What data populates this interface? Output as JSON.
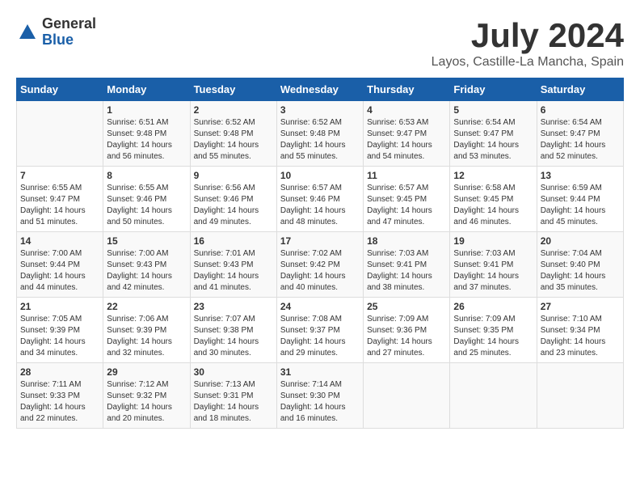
{
  "logo": {
    "general": "General",
    "blue": "Blue"
  },
  "title": "July 2024",
  "location": "Layos, Castille-La Mancha, Spain",
  "days_of_week": [
    "Sunday",
    "Monday",
    "Tuesday",
    "Wednesday",
    "Thursday",
    "Friday",
    "Saturday"
  ],
  "weeks": [
    [
      {
        "day": "",
        "info": ""
      },
      {
        "day": "1",
        "info": "Sunrise: 6:51 AM\nSunset: 9:48 PM\nDaylight: 14 hours\nand 56 minutes."
      },
      {
        "day": "2",
        "info": "Sunrise: 6:52 AM\nSunset: 9:48 PM\nDaylight: 14 hours\nand 55 minutes."
      },
      {
        "day": "3",
        "info": "Sunrise: 6:52 AM\nSunset: 9:48 PM\nDaylight: 14 hours\nand 55 minutes."
      },
      {
        "day": "4",
        "info": "Sunrise: 6:53 AM\nSunset: 9:47 PM\nDaylight: 14 hours\nand 54 minutes."
      },
      {
        "day": "5",
        "info": "Sunrise: 6:54 AM\nSunset: 9:47 PM\nDaylight: 14 hours\nand 53 minutes."
      },
      {
        "day": "6",
        "info": "Sunrise: 6:54 AM\nSunset: 9:47 PM\nDaylight: 14 hours\nand 52 minutes."
      }
    ],
    [
      {
        "day": "7",
        "info": "Sunrise: 6:55 AM\nSunset: 9:47 PM\nDaylight: 14 hours\nand 51 minutes."
      },
      {
        "day": "8",
        "info": "Sunrise: 6:55 AM\nSunset: 9:46 PM\nDaylight: 14 hours\nand 50 minutes."
      },
      {
        "day": "9",
        "info": "Sunrise: 6:56 AM\nSunset: 9:46 PM\nDaylight: 14 hours\nand 49 minutes."
      },
      {
        "day": "10",
        "info": "Sunrise: 6:57 AM\nSunset: 9:46 PM\nDaylight: 14 hours\nand 48 minutes."
      },
      {
        "day": "11",
        "info": "Sunrise: 6:57 AM\nSunset: 9:45 PM\nDaylight: 14 hours\nand 47 minutes."
      },
      {
        "day": "12",
        "info": "Sunrise: 6:58 AM\nSunset: 9:45 PM\nDaylight: 14 hours\nand 46 minutes."
      },
      {
        "day": "13",
        "info": "Sunrise: 6:59 AM\nSunset: 9:44 PM\nDaylight: 14 hours\nand 45 minutes."
      }
    ],
    [
      {
        "day": "14",
        "info": "Sunrise: 7:00 AM\nSunset: 9:44 PM\nDaylight: 14 hours\nand 44 minutes."
      },
      {
        "day": "15",
        "info": "Sunrise: 7:00 AM\nSunset: 9:43 PM\nDaylight: 14 hours\nand 42 minutes."
      },
      {
        "day": "16",
        "info": "Sunrise: 7:01 AM\nSunset: 9:43 PM\nDaylight: 14 hours\nand 41 minutes."
      },
      {
        "day": "17",
        "info": "Sunrise: 7:02 AM\nSunset: 9:42 PM\nDaylight: 14 hours\nand 40 minutes."
      },
      {
        "day": "18",
        "info": "Sunrise: 7:03 AM\nSunset: 9:41 PM\nDaylight: 14 hours\nand 38 minutes."
      },
      {
        "day": "19",
        "info": "Sunrise: 7:03 AM\nSunset: 9:41 PM\nDaylight: 14 hours\nand 37 minutes."
      },
      {
        "day": "20",
        "info": "Sunrise: 7:04 AM\nSunset: 9:40 PM\nDaylight: 14 hours\nand 35 minutes."
      }
    ],
    [
      {
        "day": "21",
        "info": "Sunrise: 7:05 AM\nSunset: 9:39 PM\nDaylight: 14 hours\nand 34 minutes."
      },
      {
        "day": "22",
        "info": "Sunrise: 7:06 AM\nSunset: 9:39 PM\nDaylight: 14 hours\nand 32 minutes."
      },
      {
        "day": "23",
        "info": "Sunrise: 7:07 AM\nSunset: 9:38 PM\nDaylight: 14 hours\nand 30 minutes."
      },
      {
        "day": "24",
        "info": "Sunrise: 7:08 AM\nSunset: 9:37 PM\nDaylight: 14 hours\nand 29 minutes."
      },
      {
        "day": "25",
        "info": "Sunrise: 7:09 AM\nSunset: 9:36 PM\nDaylight: 14 hours\nand 27 minutes."
      },
      {
        "day": "26",
        "info": "Sunrise: 7:09 AM\nSunset: 9:35 PM\nDaylight: 14 hours\nand 25 minutes."
      },
      {
        "day": "27",
        "info": "Sunrise: 7:10 AM\nSunset: 9:34 PM\nDaylight: 14 hours\nand 23 minutes."
      }
    ],
    [
      {
        "day": "28",
        "info": "Sunrise: 7:11 AM\nSunset: 9:33 PM\nDaylight: 14 hours\nand 22 minutes."
      },
      {
        "day": "29",
        "info": "Sunrise: 7:12 AM\nSunset: 9:32 PM\nDaylight: 14 hours\nand 20 minutes."
      },
      {
        "day": "30",
        "info": "Sunrise: 7:13 AM\nSunset: 9:31 PM\nDaylight: 14 hours\nand 18 minutes."
      },
      {
        "day": "31",
        "info": "Sunrise: 7:14 AM\nSunset: 9:30 PM\nDaylight: 14 hours\nand 16 minutes."
      },
      {
        "day": "",
        "info": ""
      },
      {
        "day": "",
        "info": ""
      },
      {
        "day": "",
        "info": ""
      }
    ]
  ]
}
